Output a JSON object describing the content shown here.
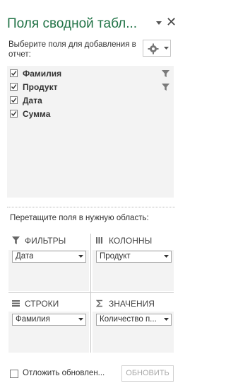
{
  "pane": {
    "title": "Поля сводной табл...",
    "choose_label": "Выберите поля для добавления в отчет:",
    "drag_label": "Перетащите поля в нужную область:"
  },
  "fields": [
    {
      "name": "Фамилия",
      "checked": true,
      "filtered": true
    },
    {
      "name": "Продукт",
      "checked": true,
      "filtered": true
    },
    {
      "name": "Дата",
      "checked": true,
      "filtered": false
    },
    {
      "name": "Сумма",
      "checked": true,
      "filtered": false
    }
  ],
  "areas": {
    "filters": {
      "label": "ФИЛЬТРЫ",
      "icon": "filter-icon",
      "item": "Дата"
    },
    "columns": {
      "label": "КОЛОННЫ",
      "icon": "columns-icon",
      "item": "Продукт"
    },
    "rows": {
      "label": "СТРОКИ",
      "icon": "rows-icon",
      "item": "Фамилия"
    },
    "values": {
      "label": "ЗНАЧЕНИЯ",
      "icon": "sigma-icon",
      "item": "Количество п..."
    }
  },
  "footer": {
    "defer_label": "Отложить обновлен...",
    "update_label": "ОБНОВИТЬ"
  },
  "colors": {
    "accent": "#217346",
    "panel_bg": "#f3f3f3"
  }
}
